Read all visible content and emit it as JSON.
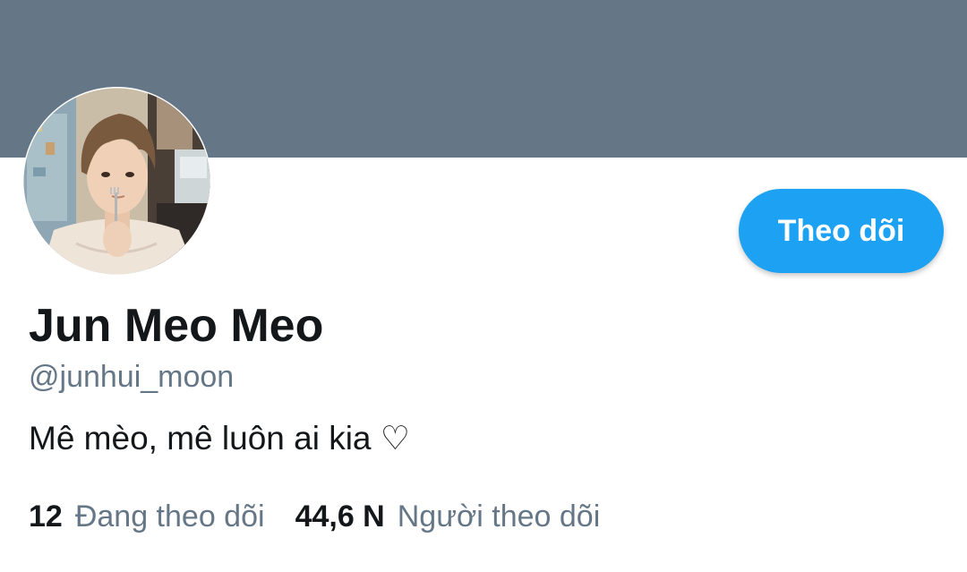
{
  "profile": {
    "display_name": "Jun Meo Meo",
    "handle": "@junhui_moon",
    "bio": "Mê mèo, mê luôn ai kia ♡",
    "follow_label": "Theo dõi",
    "stats": {
      "following_count": "12",
      "following_label": "Đang theo dõi",
      "followers_count": "44,6 N",
      "followers_label": "Người theo dõi"
    }
  },
  "colors": {
    "banner": "#657786",
    "accent": "#1da1f2",
    "text_primary": "#14171a",
    "text_secondary": "#657786"
  },
  "icons": {
    "avatar": "profile-photo"
  }
}
